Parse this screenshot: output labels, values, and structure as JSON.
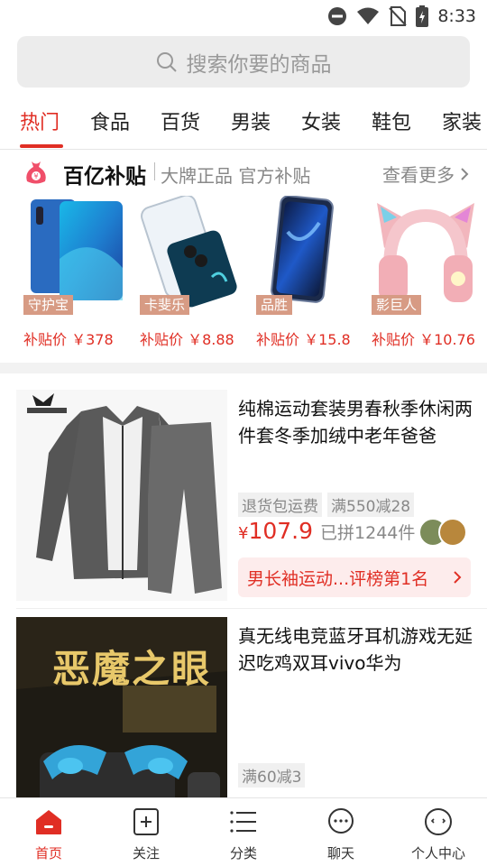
{
  "status_bar": {
    "time": "8:33"
  },
  "search": {
    "placeholder": "搜索你要的商品"
  },
  "tabs": [
    {
      "label": "热门",
      "active": true
    },
    {
      "label": "食品"
    },
    {
      "label": "百货"
    },
    {
      "label": "男装"
    },
    {
      "label": "女装"
    },
    {
      "label": "鞋包"
    },
    {
      "label": "家装"
    }
  ],
  "subsidy": {
    "title": "百亿补贴",
    "subtitle": "大牌正品 官方补贴",
    "more": "查看更多",
    "items": [
      {
        "tag": "守护宝",
        "price": "补贴价 ￥378"
      },
      {
        "tag": "卡斐乐",
        "price": "补贴价 ￥8.88"
      },
      {
        "tag": "品胜",
        "price": "补贴价 ￥15.8"
      },
      {
        "tag": "影巨人",
        "price": "补贴价 ￥10.76"
      }
    ]
  },
  "products": [
    {
      "title": "纯棉运动套装男春秋季休闲两件套冬季加绒中老年爸爸",
      "tags": [
        "退货包运费",
        "满550减28"
      ],
      "yen": "¥",
      "price": "107.9",
      "sold": "已拼1244件",
      "rank": "男长袖运动...评榜第1名"
    },
    {
      "title": "真无线电竞蓝牙耳机游戏无延迟吃鸡双耳vivo华为",
      "tags": [
        "满60减3"
      ],
      "image_text": "恶魔之眼"
    }
  ],
  "bottom_nav": [
    {
      "label": "首页",
      "icon": "home-icon",
      "active": true
    },
    {
      "label": "关注",
      "icon": "follow-icon"
    },
    {
      "label": "分类",
      "icon": "category-icon"
    },
    {
      "label": "聊天",
      "icon": "chat-icon"
    },
    {
      "label": "个人中心",
      "icon": "profile-icon"
    }
  ],
  "colors": {
    "accent": "#e02e24",
    "tag_bg": "#d79b84",
    "rank_bg": "#fdecec"
  }
}
